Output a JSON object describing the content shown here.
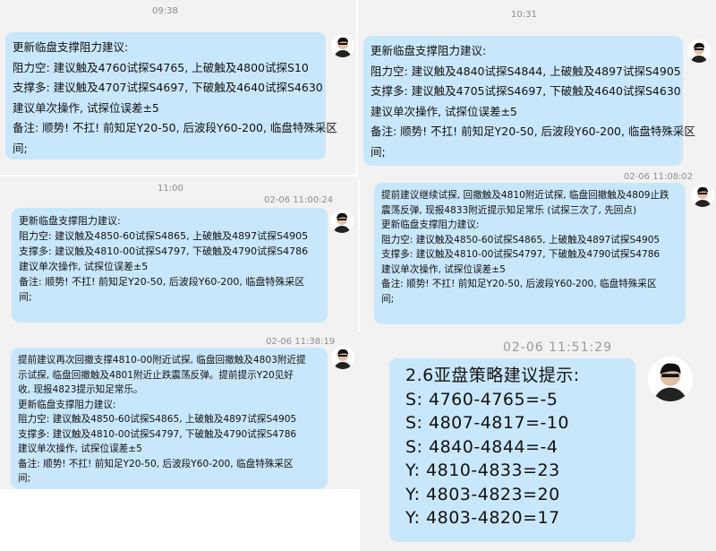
{
  "panels": [
    {
      "time": "09:38",
      "messages": [
        {
          "lines": [
            "更新临盘支撑阻力建议:",
            "阻力空: 建议触及4760试探S4765, 上破触及4800试探S10",
            "支撑多: 建议触及4707试探S4697, 下破触及4640试探S4630",
            "建议单次操作, 试探位误差±5",
            "备注: 顺势! 不扛! 前知足Y20-50, 后波段Y60-200, 临盘特殊采区",
            "间;"
          ]
        }
      ]
    },
    {
      "time": "10:31",
      "messages": [
        {
          "lines": [
            "更新临盘支撑阻力建议:",
            "阻力空: 建议触及4840试探S4844, 上破触及4897试探S4905",
            "支撑多: 建议触及4705试探S4697, 下破触及4640试探S4630",
            "建议单次操作, 试探位误差±5",
            "备注: 顺势! 不扛! 前知足Y20-50, 后波段Y60-200, 临盘特殊采区",
            "间;"
          ]
        }
      ]
    },
    {
      "time": "11:00",
      "messages": [
        {
          "stamp": "02-06 11:00:24",
          "lines": [
            "更新临盘支撑阻力建议:",
            "阻力空: 建议触及4850-60试探S4865, 上破触及4897试探S4905",
            "支撑多: 建议触及4810-00试探S4797, 下破触及4790试探S4786",
            "建议单次操作, 试探位误差±5",
            "备注: 顺势! 不扛! 前知足Y20-50, 后波段Y60-200, 临盘特殊采区",
            "间;"
          ]
        }
      ]
    },
    {
      "time": "",
      "messages": [
        {
          "stamp": "02-06 11:08:02",
          "lines": [
            "提前建议继续试探, 回撤触及4810附近试探, 临盘回撤触及4809止跌",
            "震荡反弹, 现报4833附近提示知足常乐 (试探三次了, 先回点)",
            "更新临盘支撑阻力建议:",
            "阻力空: 建议触及4850-60试探S4865, 上破触及4897试探S4905",
            "支撑多: 建议触及4810-00试探S4797, 下破触及4790试探S4786",
            "建议单次操作, 试探位误差±5",
            "备注: 顺势! 不扛! 前知足Y20-50, 后波段Y60-200, 临盘特殊采区",
            "间;"
          ]
        }
      ]
    },
    {
      "time": "",
      "messages": [
        {
          "stamp": "02-06 11:38:19",
          "lines": [
            "提前建议再次回撤支撑4810-00附近试探, 临盘回撤触及4803附近提",
            "示试探, 临盘回撤触及4801附近止跌震荡反弹。提前提示Y20见好",
            "收, 现报4823提示知足常乐。",
            "更新临盘支撑阻力建议:",
            "阻力空: 建议触及4850-60试探S4865, 上破触及4897试探S4905",
            "支撑多: 建议触及4810-00试探S4797, 下破触及4790试探S4786",
            "建议单次操作, 试探位误差±5",
            "备注: 顺势! 不扛! 前知足Y20-50, 后波段Y60-200, 临盘特殊采区",
            "间;"
          ]
        }
      ]
    },
    {
      "time": "",
      "messages": [
        {
          "stamp": "02-06 11:51:29",
          "lines": [
            "2.6亚盘策略建议提示:",
            "S: 4760-4765=-5",
            "S: 4807-4817=-10",
            "S: 4840-4844=-4",
            "Y: 4810-4833=23",
            "Y: 4803-4823=20",
            "Y: 4803-4820=17"
          ]
        }
      ]
    }
  ],
  "colors": {
    "panel_bg": "#f2f2f2",
    "bubble_bg": "#c9e7fb",
    "timestamp": "#8c8c8c"
  },
  "icons": {
    "avatar": "avatar-icon"
  }
}
